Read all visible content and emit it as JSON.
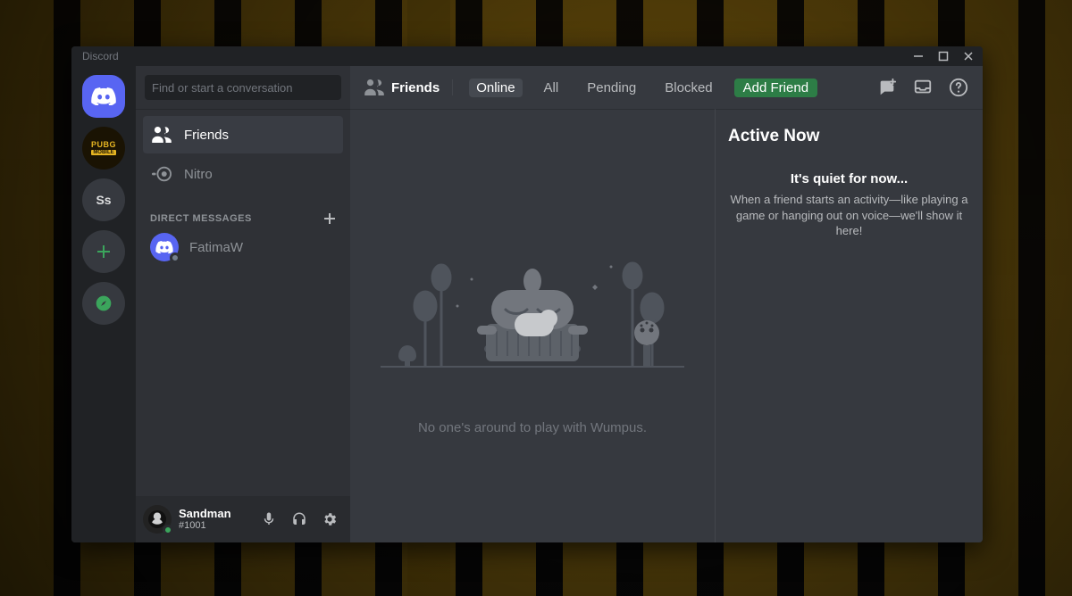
{
  "titlebar": {
    "title": "Discord"
  },
  "rail": {
    "home_name": "Home",
    "servers": [
      {
        "name": "PUBG MOBILE",
        "short_top": "PUBG",
        "short_bottom": "MOBILE"
      },
      {
        "name": "Ss Server",
        "initials": "Ss"
      }
    ]
  },
  "sidebar": {
    "search_placeholder": "Find or start a conversation",
    "nav": {
      "friends_label": "Friends",
      "nitro_label": "Nitro"
    },
    "dm_header": "DIRECT MESSAGES",
    "dms": [
      {
        "name": "FatimaW"
      }
    ]
  },
  "user": {
    "name": "Sandman",
    "tag": "#1001"
  },
  "topbar": {
    "section": "Friends",
    "tabs": {
      "online": "Online",
      "all": "All",
      "pending": "Pending",
      "blocked": "Blocked",
      "add_friend": "Add Friend"
    }
  },
  "empty": {
    "caption": "No one's around to play with Wumpus."
  },
  "active_now": {
    "title": "Active Now",
    "sub_title": "It's quiet for now...",
    "sub_body": "When a friend starts an activity—like playing a game or hanging out on voice—we'll show it here!"
  }
}
